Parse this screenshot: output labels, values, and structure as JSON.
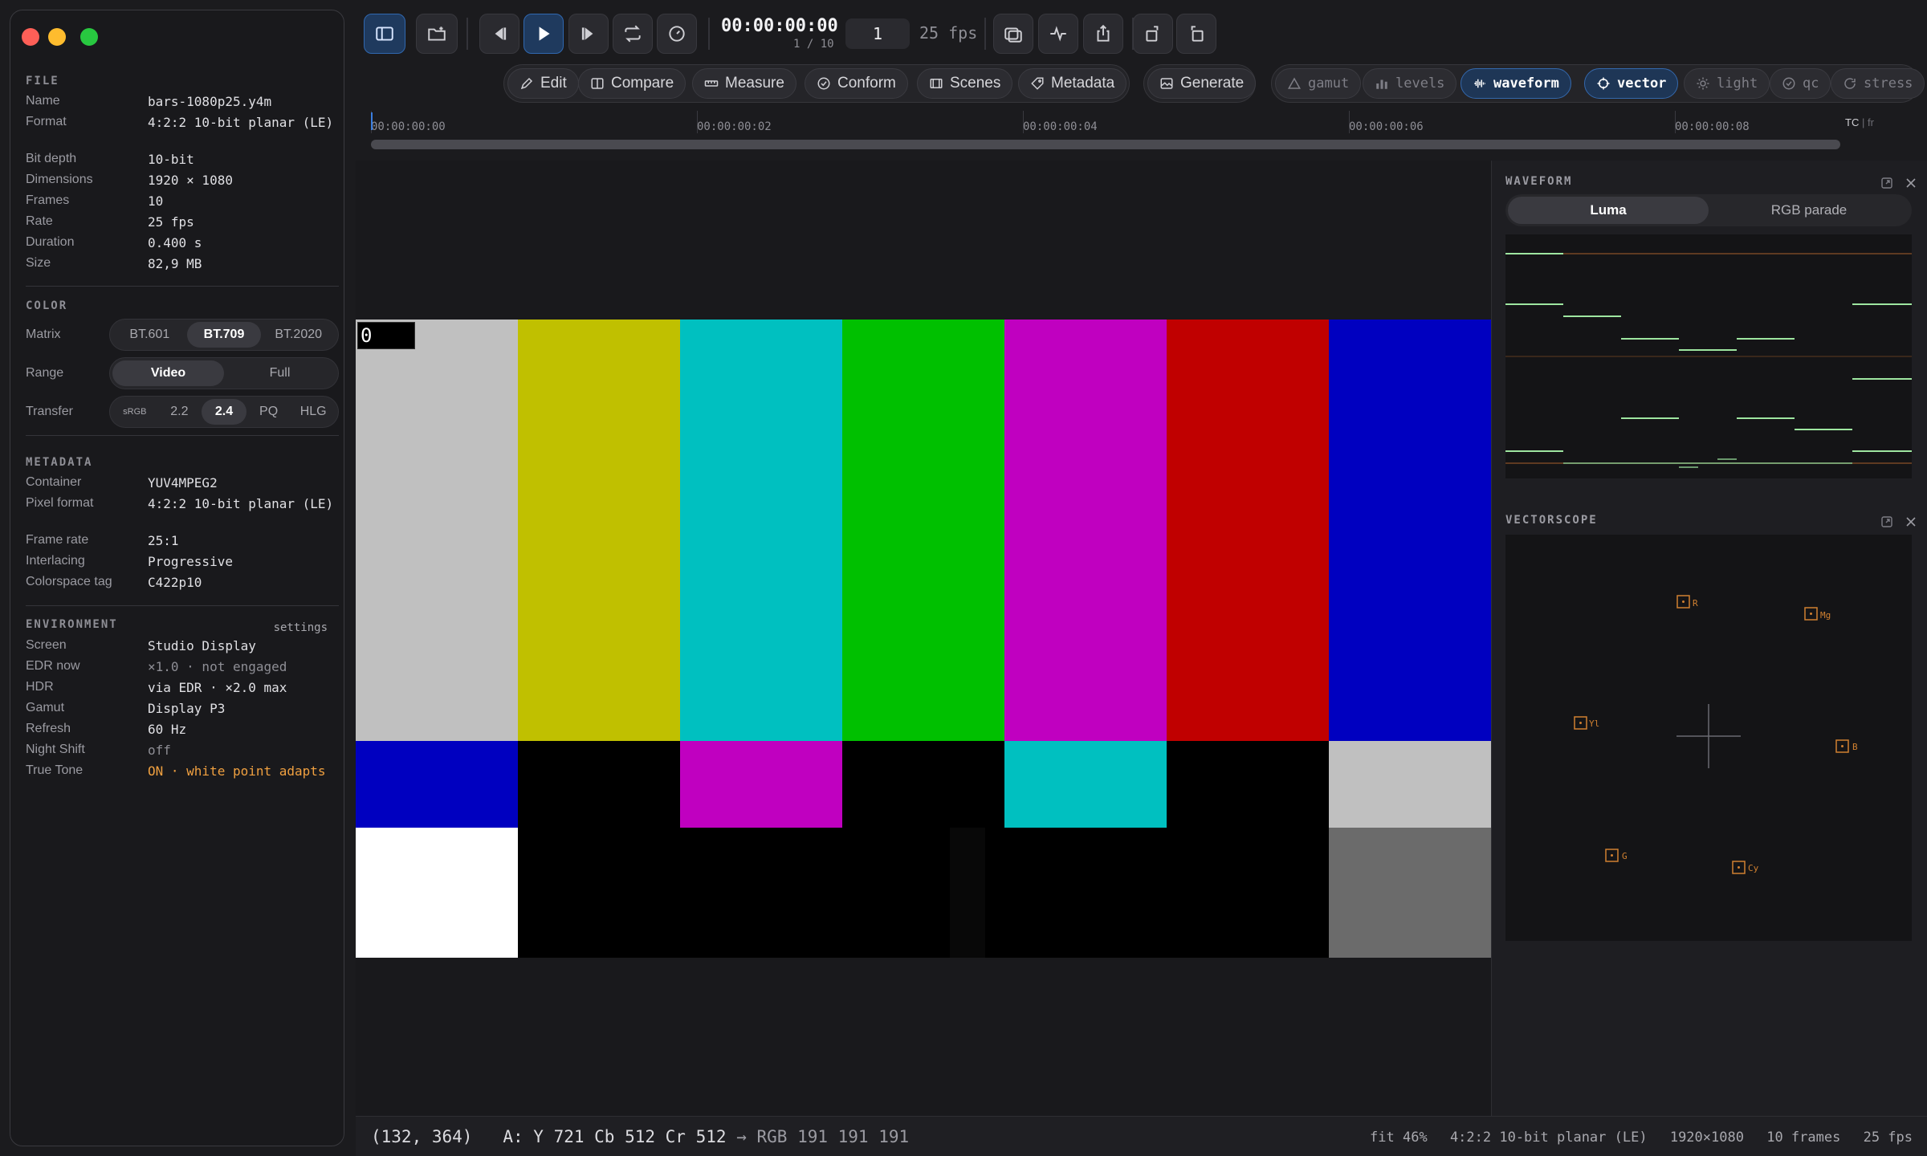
{
  "sidebar": {
    "file": {
      "title": "FILE",
      "rows": [
        {
          "key": "Name",
          "value": "bars-1080p25.y4m"
        },
        {
          "key": "Format",
          "value": "4:2:2 10-bit planar (LE)"
        },
        {
          "key": "Bit depth",
          "value": "10-bit"
        },
        {
          "key": "Dimensions",
          "value": "1920 × 1080"
        },
        {
          "key": "Frames",
          "value": "10"
        },
        {
          "key": "Rate",
          "value": "25 fps"
        },
        {
          "key": "Duration",
          "value": "0.400 s"
        },
        {
          "key": "Size",
          "value": "82,9 MB"
        }
      ]
    },
    "color": {
      "title": "COLOR",
      "matrix": {
        "label": "Matrix",
        "options": [
          "BT.601",
          "BT.709",
          "BT.2020"
        ],
        "selected": "BT.709"
      },
      "range": {
        "label": "Range",
        "options": [
          "Video",
          "Full"
        ],
        "selected": "Video"
      },
      "transfer": {
        "label": "Transfer",
        "options": [
          "sRGB",
          "2.2",
          "2.4",
          "PQ",
          "HLG"
        ],
        "selected": "2.4"
      }
    },
    "metadata": {
      "title": "METADATA",
      "rows": [
        {
          "key": "Container",
          "value": "YUV4MPEG2"
        },
        {
          "key": "Pixel format",
          "value": "4:2:2 10-bit planar (LE)"
        },
        {
          "key": "Frame rate",
          "value": "25:1"
        },
        {
          "key": "Interlacing",
          "value": "Progressive"
        },
        {
          "key": "Colorspace tag",
          "value": "C422p10"
        }
      ]
    },
    "environment": {
      "title": "ENVIRONMENT",
      "settings_link": "settings",
      "rows": [
        {
          "key": "Screen",
          "value": "Studio Display"
        },
        {
          "key": "EDR now",
          "value": "×1.0 · not engaged"
        },
        {
          "key": "HDR",
          "value": "via EDR · ×2.0 max"
        },
        {
          "key": "Gamut",
          "value": "Display P3"
        },
        {
          "key": "Refresh",
          "value": "60 Hz"
        },
        {
          "key": "Night Shift",
          "value": "off"
        },
        {
          "key": "True Tone",
          "value": "ON · white point adapts"
        }
      ]
    }
  },
  "toolbar": {
    "icons": [
      "sidebar-toggle-icon",
      "open-folder-icon",
      "step-back-icon",
      "play-icon",
      "step-forward-icon",
      "loop-icon",
      "speed-icon",
      "compare-icon",
      "activity-icon",
      "share-icon",
      "rotate-right-icon",
      "rotate-left-icon"
    ],
    "timecode": "00:00:00:00",
    "frame_of": "1 / 10",
    "frame_value": "1",
    "fps": "25 fps"
  },
  "tools": {
    "main": [
      "Edit",
      "Compare",
      "Measure",
      "Conform",
      "Scenes",
      "Metadata"
    ],
    "generate": "Generate",
    "overlays": [
      {
        "label": "gamut",
        "on": false
      },
      {
        "label": "levels",
        "on": false
      },
      {
        "label": "waveform",
        "on": true
      },
      {
        "label": "vector",
        "on": true
      },
      {
        "label": "light",
        "on": false
      },
      {
        "label": "qc",
        "on": false
      },
      {
        "label": "stress",
        "on": false
      }
    ]
  },
  "timeline": {
    "ticks": [
      "00:00:00:00",
      "00:00:00:02",
      "00:00:00:04",
      "00:00:00:06",
      "00:00:00:08"
    ],
    "mode_on": "TC",
    "mode_sep": "|",
    "mode_off": "fr"
  },
  "viewer": {
    "frame_counter": "0",
    "top_bars": [
      "#c0c0c0",
      "#c0c000",
      "#00c0c0",
      "#00c000",
      "#c000c0",
      "#c00000",
      "#0000c0"
    ],
    "mid_bars": [
      "#0000c0",
      "#000000",
      "#c000c0",
      "#000000",
      "#00c0c0",
      "#000000",
      "#c0c0c0"
    ],
    "bottom_bars": [
      "#ffffff",
      "#000000",
      "#000000",
      "#000000",
      "#000000",
      "#000000",
      "#6b6b6b"
    ]
  },
  "scopes": {
    "waveform": {
      "title": "WAVEFORM",
      "modes": [
        "Luma",
        "RGB parade"
      ],
      "selected": "Luma"
    },
    "vectorscope": {
      "title": "VECTORSCOPE",
      "targets": [
        "R",
        "Mg",
        "Yl",
        "B",
        "G",
        "Cy"
      ]
    }
  },
  "status": {
    "coords": "(132, 364)",
    "sample": "A: Y 721 Cb 512 Cr 512",
    "arrow": "→",
    "rgb": "RGB 191 191 191",
    "fit": "fit 46%",
    "format": "4:2:2 10-bit planar (LE)",
    "resolution": "1920×1080",
    "frames": "10 frames",
    "fps": "25 fps"
  },
  "colors": {
    "accent": "#3a7ee0",
    "waveform_trace": "#9ee6a0",
    "graticule": "#a0602c",
    "vector_target": "#d08030",
    "true_tone": "#f0a040"
  }
}
